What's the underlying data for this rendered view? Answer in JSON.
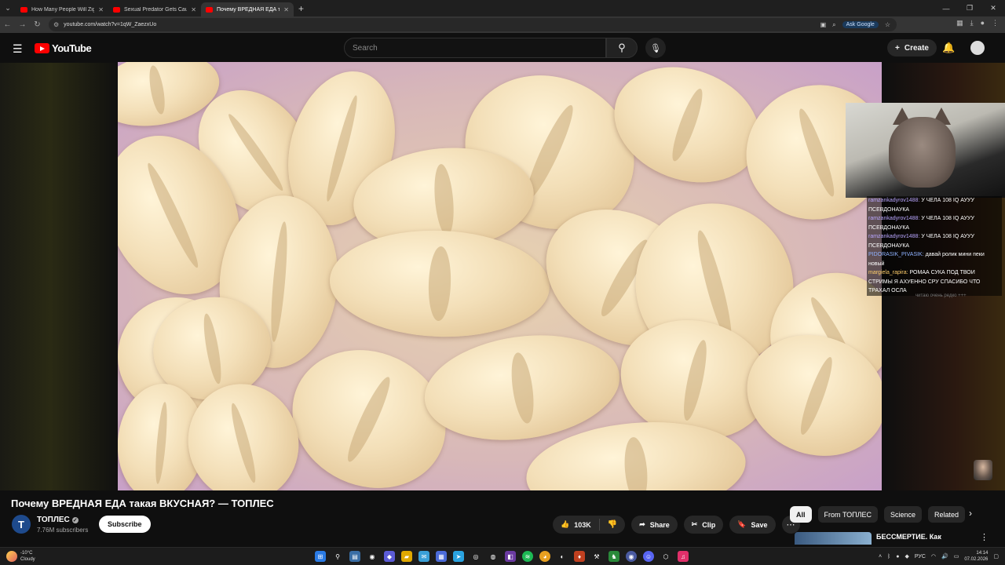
{
  "browser": {
    "tabs": [
      {
        "title": "How Many People Will Zigan"
      },
      {
        "title": "Sexual Predator Gets Caught in"
      },
      {
        "title": "Почему ВРЕДНАЯ ЕДА такая В"
      }
    ],
    "url": "youtube.com/watch?v=1qW_ZaezxUo",
    "ask_google": "Ask Google"
  },
  "youtube": {
    "logo_text": "YouTube",
    "search_placeholder": "Search",
    "create_label": "Create"
  },
  "stream_chat": [
    {
      "user": "ramzankadyrov1488:",
      "text": "У ЧЕЛА 108 IQ АУУУ ПСЕВДОНАУКА",
      "color": "#b9a6ff"
    },
    {
      "user": "ramzankadyrov1488:",
      "text": "У ЧЕЛА 108 IQ АУУУ ПСЕВДОНАУКА",
      "color": "#b9a6ff"
    },
    {
      "user": "ramzankadyrov1488:",
      "text": "У ЧЕЛА 108 IQ АУУУ ПСЕВДОНАУКА",
      "color": "#b9a6ff"
    },
    {
      "user": "PIDORASIK_PIVASIK:",
      "text": "давай ролик мини пеки новый",
      "color": "#8fb2ff"
    },
    {
      "user": "margiela_rapira:",
      "text": "РОМАА СУКА ПОД ТВОИ СТРИМЫ Я АХУЕННО СРУ СПАСИБО ЧТО ТРАХАЛ ОСЛА",
      "color": "#ffce6b"
    }
  ],
  "chat_footer": "читаю очень редко +++",
  "video": {
    "title": "Почему ВРЕДНАЯ ЕДА такая ВКУСНАЯ? — ТОПЛЕС",
    "channel": "ТОПЛЕС",
    "channel_initial": "T",
    "subscribers": "7.76M subscribers",
    "subscribe_label": "Subscribe",
    "likes": "103K",
    "share_label": "Share",
    "clip_label": "Clip",
    "save_label": "Save"
  },
  "chips": [
    "All",
    "From ТОПЛЕС",
    "Science",
    "Related"
  ],
  "recommendation": {
    "title": "БЕССМЕРТИЕ. Как миллиардеры пытаются"
  },
  "taskbar": {
    "weather_temp": "-10°C",
    "weather_desc": "Cloudy",
    "lang": "РУС",
    "time": "14:14",
    "date": "07.02.2026"
  },
  "colors": {
    "youtube_red": "#ff0000",
    "background": "#0f0f0f"
  }
}
